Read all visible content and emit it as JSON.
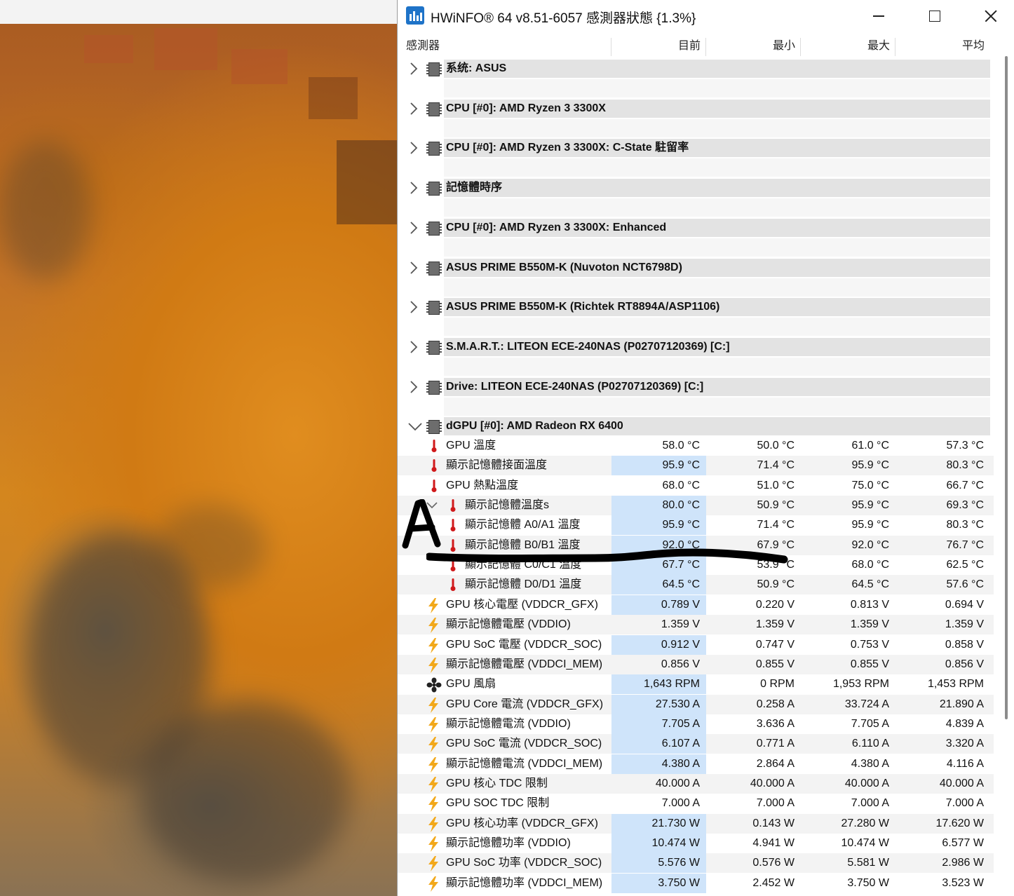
{
  "window": {
    "title": "HWiNFO® 64 v8.51-6057 感測器狀態 {1.3%}",
    "app_icon": "hwinfo-app-icon",
    "controls": [
      "minimize",
      "maximize",
      "close"
    ]
  },
  "columns": {
    "sensor": "感測器",
    "current": "目前",
    "min": "最小",
    "max": "最大",
    "avg": "平均"
  },
  "groups": [
    {
      "label": "系统: ASUS",
      "expanded": false
    },
    {
      "label": "CPU [#0]: AMD Ryzen 3 3300X",
      "expanded": false
    },
    {
      "label": "CPU [#0]: AMD Ryzen 3 3300X: C-State 駐留率",
      "expanded": false
    },
    {
      "label": "記憶體時序",
      "expanded": false
    },
    {
      "label": "CPU [#0]: AMD Ryzen 3 3300X: Enhanced",
      "expanded": false
    },
    {
      "label": "ASUS PRIME B550M-K (Nuvoton NCT6798D)",
      "expanded": false
    },
    {
      "label": "ASUS PRIME B550M-K (Richtek RT8894A/ASP1106)",
      "expanded": false
    },
    {
      "label": "S.M.A.R.T.: LITEON ECE-240NAS (P02707120369) [C:]",
      "expanded": false
    },
    {
      "label": "Drive: LITEON ECE-240NAS (P02707120369) [C:]",
      "expanded": false
    },
    {
      "label": "dGPU [#0]: AMD Radeon RX 6400",
      "expanded": true
    }
  ],
  "sensors": [
    {
      "name": "GPU 溫度",
      "icon": "thermometer-icon",
      "cur": "58.0 °C",
      "min": "50.0 °C",
      "max": "61.0 °C",
      "avg": "57.3 °C",
      "hl": false
    },
    {
      "name": "顯示記憶體接面溫度",
      "icon": "thermometer-icon",
      "cur": "95.9 °C",
      "min": "71.4 °C",
      "max": "95.9 °C",
      "avg": "80.3 °C",
      "hl": true
    },
    {
      "name": "GPU 熱點溫度",
      "icon": "thermometer-icon",
      "cur": "68.0 °C",
      "min": "51.0 °C",
      "max": "75.0 °C",
      "avg": "66.7 °C",
      "hl": false
    },
    {
      "name": "顯示記憶體溫度s",
      "icon": "thermometer-icon",
      "cur": "80.0 °C",
      "min": "50.9 °C",
      "max": "95.9 °C",
      "avg": "69.3 °C",
      "hl": true,
      "indent": 1,
      "expander": true
    },
    {
      "name": "顯示記憶體 A0/A1 溫度",
      "icon": "thermometer-icon",
      "cur": "95.9 °C",
      "min": "71.4 °C",
      "max": "95.9 °C",
      "avg": "80.3 °C",
      "hl": true,
      "indent": 1
    },
    {
      "name": "顯示記憶體 B0/B1 溫度",
      "icon": "thermometer-icon",
      "cur": "92.0 °C",
      "min": "67.9 °C",
      "max": "92.0 °C",
      "avg": "76.7 °C",
      "hl": true,
      "indent": 1
    },
    {
      "name": "顯示記憶體 C0/C1 溫度",
      "icon": "thermometer-icon",
      "cur": "67.7 °C",
      "min": "53.9 °C",
      "max": "68.0 °C",
      "avg": "62.5 °C",
      "hl": true,
      "indent": 1
    },
    {
      "name": "顯示記憶體 D0/D1 溫度",
      "icon": "thermometer-icon",
      "cur": "64.5 °C",
      "min": "50.9 °C",
      "max": "64.5 °C",
      "avg": "57.6 °C",
      "hl": true,
      "indent": 1
    },
    {
      "name": "GPU 核心電壓 (VDDCR_GFX)",
      "icon": "lightning-icon",
      "cur": "0.789 V",
      "min": "0.220 V",
      "max": "0.813 V",
      "avg": "0.694 V",
      "hl": true
    },
    {
      "name": "顯示記憶體電壓 (VDDIO)",
      "icon": "lightning-icon",
      "cur": "1.359 V",
      "min": "1.359 V",
      "max": "1.359 V",
      "avg": "1.359 V",
      "hl": false
    },
    {
      "name": "GPU SoC 電壓 (VDDCR_SOC)",
      "icon": "lightning-icon",
      "cur": "0.912 V",
      "min": "0.747 V",
      "max": "0.753 V",
      "avg": "0.858 V",
      "hl": true
    },
    {
      "name": "顯示記憶體電壓 (VDDCI_MEM)",
      "icon": "lightning-icon",
      "cur": "0.856 V",
      "min": "0.855 V",
      "max": "0.855 V",
      "avg": "0.856 V",
      "hl": false
    },
    {
      "name": "GPU 風扇",
      "icon": "fan-icon",
      "cur": "1,643 RPM",
      "min": "0 RPM",
      "max": "1,953 RPM",
      "avg": "1,453 RPM",
      "hl": true
    },
    {
      "name": "GPU Core 電流 (VDDCR_GFX)",
      "icon": "lightning-icon",
      "cur": "27.530 A",
      "min": "0.258 A",
      "max": "33.724 A",
      "avg": "21.890 A",
      "hl": true
    },
    {
      "name": "顯示記憶體電流 (VDDIO)",
      "icon": "lightning-icon",
      "cur": "7.705 A",
      "min": "3.636 A",
      "max": "7.705 A",
      "avg": "4.839 A",
      "hl": true
    },
    {
      "name": "GPU SoC 電流 (VDDCR_SOC)",
      "icon": "lightning-icon",
      "cur": "6.107 A",
      "min": "0.771 A",
      "max": "6.110 A",
      "avg": "3.320 A",
      "hl": true
    },
    {
      "name": "顯示記憶體電流 (VDDCI_MEM)",
      "icon": "lightning-icon",
      "cur": "4.380 A",
      "min": "2.864 A",
      "max": "4.380 A",
      "avg": "4.116 A",
      "hl": true
    },
    {
      "name": "GPU 核心 TDC 限制",
      "icon": "lightning-icon",
      "cur": "40.000 A",
      "min": "40.000 A",
      "max": "40.000 A",
      "avg": "40.000 A",
      "hl": false
    },
    {
      "name": "GPU SOC TDC 限制",
      "icon": "lightning-icon",
      "cur": "7.000 A",
      "min": "7.000 A",
      "max": "7.000 A",
      "avg": "7.000 A",
      "hl": false
    },
    {
      "name": "GPU 核心功率 (VDDCR_GFX)",
      "icon": "lightning-icon",
      "cur": "21.730 W",
      "min": "0.143 W",
      "max": "27.280 W",
      "avg": "17.620 W",
      "hl": true
    },
    {
      "name": "顯示記憶體功率 (VDDIO)",
      "icon": "lightning-icon",
      "cur": "10.474 W",
      "min": "4.941 W",
      "max": "10.474 W",
      "avg": "6.577 W",
      "hl": true
    },
    {
      "name": "GPU SoC 功率 (VDDCR_SOC)",
      "icon": "lightning-icon",
      "cur": "5.576 W",
      "min": "0.576 W",
      "max": "5.581 W",
      "avg": "2.986 W",
      "hl": true
    },
    {
      "name": "顯示記憶體功率 (VDDCI_MEM)",
      "icon": "lightning-icon",
      "cur": "3.750 W",
      "min": "2.452 W",
      "max": "3.750 W",
      "avg": "3.523 W",
      "hl": true
    }
  ],
  "annotations": {
    "handwritten_letter": "A",
    "strike_line": "black-marker-line"
  },
  "colors": {
    "group_bar": "#e3e3e3",
    "highlight": "#cfe4fa",
    "thermometer": "#d0191b",
    "lightning": "#f2a81a",
    "app_icon": "#1e73c8"
  }
}
